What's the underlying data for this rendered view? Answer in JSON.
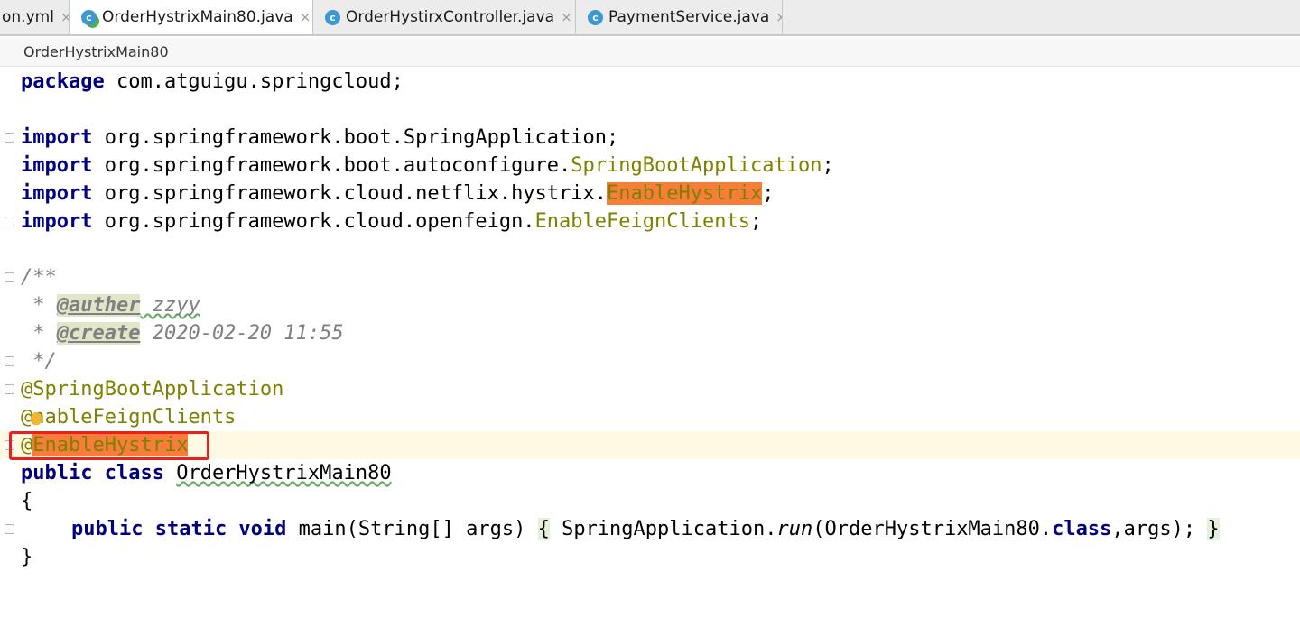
{
  "tabs": [
    {
      "label": "on.yml",
      "icon": "yaml-file-icon",
      "active": false
    },
    {
      "label": "OrderHystrixMain80.java",
      "icon": "java-main-class-icon",
      "active": true
    },
    {
      "label": "OrderHystirxController.java",
      "icon": "java-class-icon",
      "active": false
    },
    {
      "label": "PaymentService.java",
      "icon": "java-class-icon",
      "active": false
    }
  ],
  "tab_close_glyph": "×",
  "class_icon_letter": "c",
  "breadcrumb": "OrderHystrixMain80",
  "code": {
    "l1_kw": "package",
    "l1_rest": " com.atguigu.springcloud;",
    "import_kw": "import",
    "l3_rest": " org.springframework.boot.SpringApplication;",
    "l4_pkg": " org.springframework.boot.autoconfigure.",
    "l4_cls": "SpringBootApplication",
    "l5_pkg": " org.springframework.cloud.netflix.hystrix.",
    "l5_cls": "EnableHystrix",
    "l6_pkg": " org.springframework.cloud.openfeign.",
    "l6_cls": "EnableFeignClients",
    "semicolon": ";",
    "doc_open": "/**",
    "doc_star": " * ",
    "doc_tag1": "@auther",
    "doc_val1": " zzyy",
    "doc_tag2": "@create",
    "doc_val2": " 2020-02-20 11:55",
    "doc_close": " */",
    "ann1": "@SpringBootApplication",
    "ann2_at": "@",
    "ann2_rest": "nableFeignClients",
    "ann3_at": "@",
    "ann3_rest": "EnableHystrix",
    "cls_kw": "public class",
    "cls_name": "OrderHystrixMain80",
    "brace_open": "{",
    "main_kw": "public static void",
    "main_sig": " main(String[] args) ",
    "main_body_a": " SpringApplication.",
    "main_run": "run",
    "main_body_b": "(OrderHystrixMain80.",
    "main_class_kw": "class",
    "main_body_c": ",args); ",
    "brace_close": "}"
  },
  "colors": {
    "keyword": "#000080",
    "annotation": "#808000",
    "comment": "#808080",
    "search_highlight": "#f77d3a",
    "red_box": "#e8211f"
  }
}
